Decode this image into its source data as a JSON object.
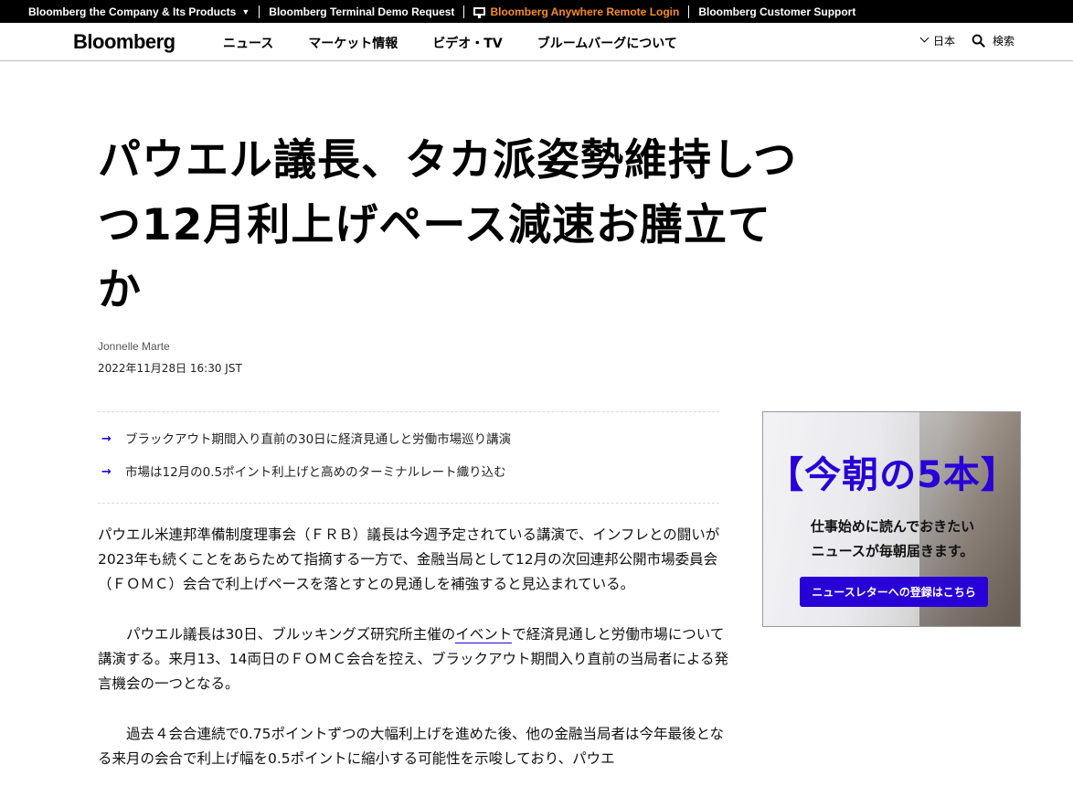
{
  "topbar": {
    "company": "Bloomberg the Company & Its Products",
    "demo": "Bloomberg Terminal Demo Request",
    "anywhere": "Bloomberg Anywhere Remote Login",
    "support": "Bloomberg Customer Support"
  },
  "nav": {
    "logo": "Bloomberg",
    "links": [
      "ニュース",
      "マーケット情報",
      "ビデオ・TV",
      "ブルームバーグについて"
    ],
    "lang": "日本",
    "search": "検索"
  },
  "article": {
    "headline_lines": [
      "パウエル議長、タカ派姿勢維持しつ",
      "つ12月利上げペース減速お膳立て",
      "か"
    ],
    "author": "Jonnelle Marte",
    "date": "2022年11月28日 16:30 JST",
    "summary": [
      "ブラックアウト期間入り直前の30日に経済見通しと労働市場巡り講演",
      "市場は12月の0.5ポイント利上げと高めのターミナルレート織り込む"
    ],
    "p1": "パウエル米連邦準備制度理事会（ＦＲＢ）議長は今週予定されている講演で、インフレとの闘いが2023年も続くことをあらためて指摘する一方で、金融当局として12月の次回連邦公開市場委員会（ＦＯＭＣ）会合で利上げペースを落とすとの見通しを補強すると見込まれている。",
    "p2_pre": "パウエル議長は30日、ブルッキングズ研究所主催の",
    "p2_link": "イベント",
    "p2_post": "で経済見通しと労働市場について講演する。来月13、14両日のＦＯＭＣ会合を控え、ブラックアウト期間入り直前の当局者による発言機会の一つとなる。",
    "p3": "過去４会合連続で0.75ポイントずつの大幅利上げを進めた後、他の金融当局者は今年最後となる来月の会合で利上げ幅を0.5ポイントに縮小する可能性を示唆しており、パウエ"
  },
  "ad": {
    "title": "【今朝の5本】",
    "sub1": "仕事始めに読んでおきたい",
    "sub2": "ニュースが毎朝届きます。",
    "button": "ニュースレターへの登録はこちら"
  },
  "colors": {
    "accent": "#2800d7",
    "orange": "#fb8b1e"
  }
}
